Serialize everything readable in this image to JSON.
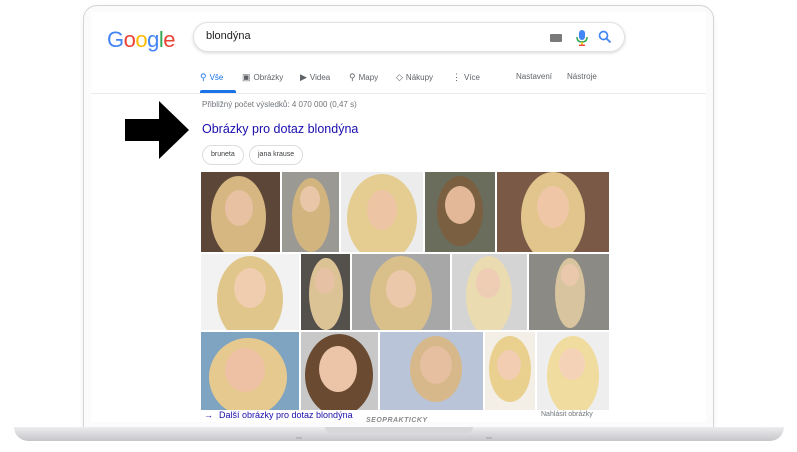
{
  "logo": {
    "letters": [
      "G",
      "o",
      "o",
      "g",
      "l",
      "e"
    ],
    "colors": [
      "#4285f4",
      "#ea4335",
      "#fbbc05",
      "#4285f4",
      "#34a853",
      "#ea4335"
    ]
  },
  "search": {
    "query": "blondýna"
  },
  "tabs": [
    {
      "label": "Vše",
      "icon": "search-icon",
      "active": true
    },
    {
      "label": "Obrázky",
      "icon": "image-icon"
    },
    {
      "label": "Videa",
      "icon": "video-icon"
    },
    {
      "label": "Mapy",
      "icon": "map-pin-icon"
    },
    {
      "label": "Nákupy",
      "icon": "tag-icon"
    },
    {
      "label": "Více",
      "icon": "more-vertical-icon"
    },
    {
      "label": "Nastavení"
    },
    {
      "label": "Nástroje"
    }
  ],
  "results": {
    "stats": "Přibližný počet výsledků: 4 070 000 (0,47 s)",
    "images_heading": "Obrázky pro dotaz blondýna",
    "chips": [
      "bruneta",
      "jana krause"
    ],
    "more_link": "Další obrázky pro dotaz blondýna",
    "report": "Nahlásit obrázky"
  },
  "footer_brand": "SEOPRAKTICKY",
  "accent_color": "#1a73e8",
  "link_color": "#1a0dab"
}
